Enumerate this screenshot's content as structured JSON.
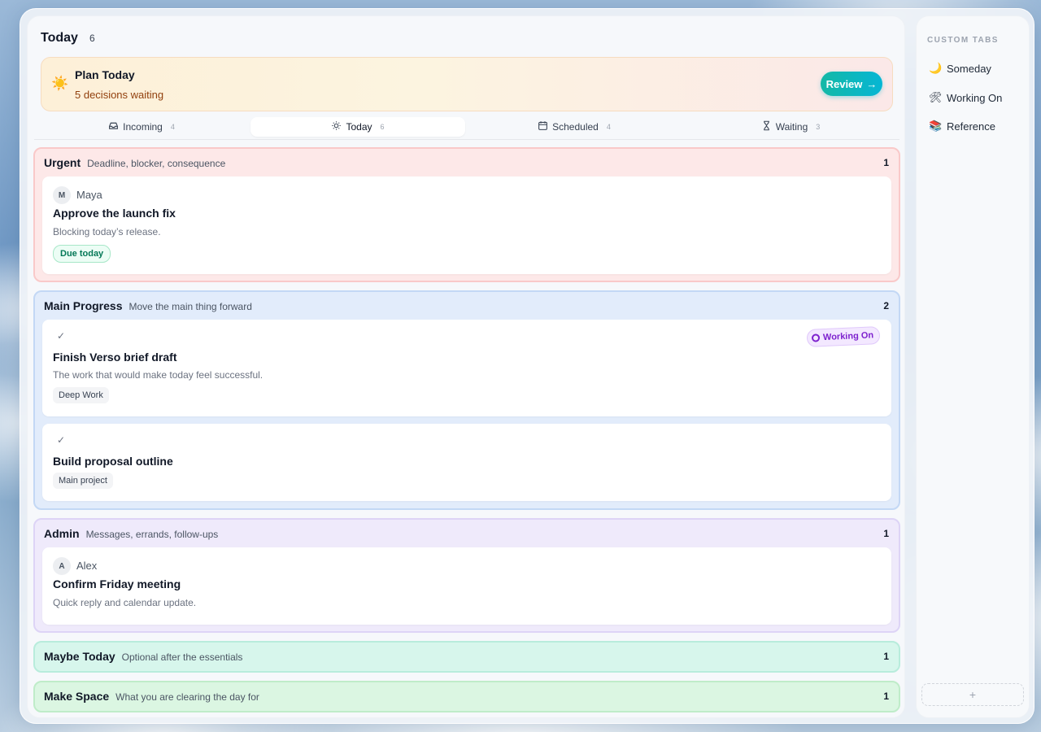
{
  "header": {
    "title": "Today",
    "count": "6"
  },
  "plan": {
    "icon": "sun-emoji",
    "title": "Plan Today",
    "subtitle": "5 decisions waiting",
    "button_label": "Review",
    "button_arrow": "→"
  },
  "tabs": [
    {
      "icon": "inbox-icon",
      "label": "Incoming",
      "count": "4"
    },
    {
      "icon": "sun-icon",
      "label": "Today",
      "count": "6",
      "active": true
    },
    {
      "icon": "calendar-icon",
      "label": "Scheduled",
      "count": "4"
    },
    {
      "icon": "hourglass-icon",
      "label": "Waiting",
      "count": "3"
    }
  ],
  "sections": {
    "urgent": {
      "title": "Urgent",
      "subtitle": "Deadline, blocker, consequence",
      "count": "1",
      "color": "#f9c9c9",
      "cards": [
        {
          "avatar": "M",
          "person": "Maya",
          "title": "Approve the launch fix",
          "desc": "Blocking today’s release.",
          "chip": "Due today"
        }
      ]
    },
    "main": {
      "title": "Main Progress",
      "subtitle": "Move the main thing forward",
      "count": "2",
      "color": "#c3d8f5",
      "cards": [
        {
          "check": "✓",
          "title": "Finish Verso brief draft",
          "desc": "The work that would make today feel successful.",
          "chip": "Deep Work",
          "tag": "Working On"
        },
        {
          "check": "✓",
          "title": "Build proposal outline",
          "chip": "Main project"
        }
      ]
    },
    "admin": {
      "title": "Admin",
      "subtitle": "Messages, errands, follow-ups",
      "count": "1",
      "color": "#ddd4f6",
      "cards": [
        {
          "avatar": "A",
          "person": "Alex",
          "title": "Confirm Friday meeting",
          "desc": "Quick reply and calendar update."
        }
      ]
    },
    "maybe": {
      "title": "Maybe Today",
      "subtitle": "Optional after the essentials",
      "count": "1",
      "color": "#b8ecdc"
    },
    "space": {
      "title": "Make Space",
      "subtitle": "What you are clearing the day for",
      "count": "1",
      "color": "#bfecc9"
    }
  },
  "sidebar": {
    "heading": "CUSTOM TABS",
    "items": [
      {
        "emoji": "🌙",
        "icon": "moon-emoji",
        "label": "Someday"
      },
      {
        "emoji": "🛠",
        "icon": "tools-emoji",
        "label": "Working On"
      },
      {
        "emoji": "📚",
        "icon": "books-emoji",
        "label": "Reference"
      }
    ],
    "add_label": "+"
  }
}
